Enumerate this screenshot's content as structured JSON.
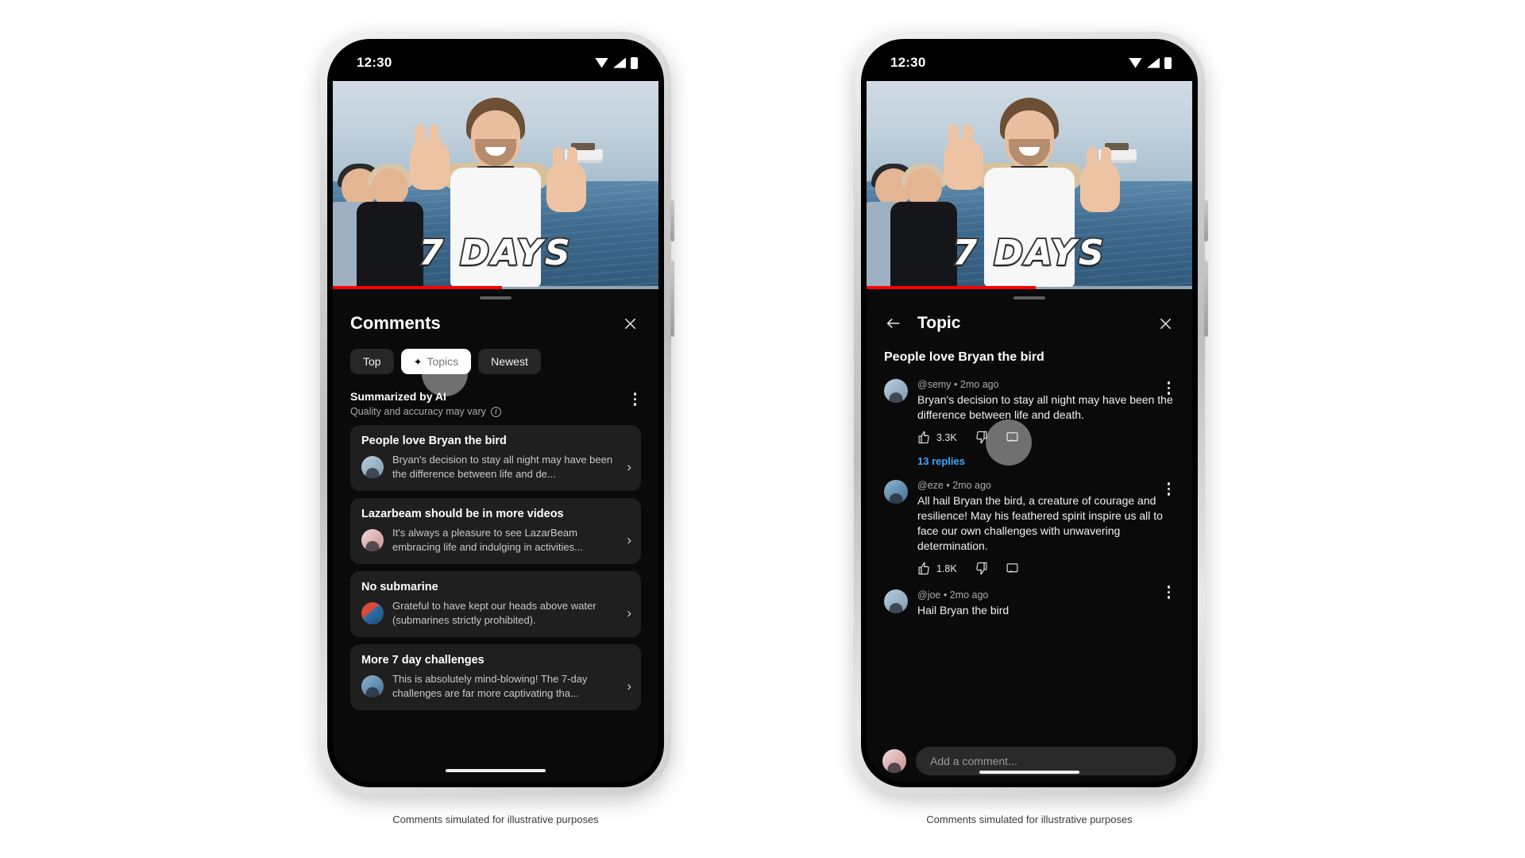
{
  "caption": "Comments simulated for illustrative purposes",
  "status_bar": {
    "time": "12:30",
    "icons": [
      "wifi-icon",
      "signal-icon",
      "battery-icon"
    ]
  },
  "video": {
    "overlay_title": "7 DAYS",
    "progress_percent": 52
  },
  "left_phone": {
    "sheet_title": "Comments",
    "close_label": "×",
    "chips": [
      {
        "label": "Top",
        "active": false,
        "icon": null
      },
      {
        "label": "Topics",
        "active": true,
        "icon": "sparkle-icon"
      },
      {
        "label": "Newest",
        "active": false,
        "icon": null
      }
    ],
    "summary": {
      "title": "Summarized by AI",
      "subtitle": "Quality and accuracy may vary",
      "info_icon": "i"
    },
    "topics": [
      {
        "title": "People love Bryan the bird",
        "snippet": "Bryan's decision to stay all night may have been the difference between life and de...",
        "avatar": "av-a"
      },
      {
        "title": "Lazarbeam should be in more videos",
        "snippet": "It's always a pleasure to see LazarBeam embracing life and indulging in activities...",
        "avatar": "av-b"
      },
      {
        "title": "No submarine",
        "snippet": "Grateful to have kept our heads above water (submarines strictly prohibited).",
        "avatar": "av-c"
      },
      {
        "title": "More 7 day challenges",
        "snippet": "This is absolutely mind-blowing! The 7-day challenges are far more captivating tha...",
        "avatar": "av-d"
      }
    ]
  },
  "right_phone": {
    "header_title": "Topic",
    "back_label": "←",
    "close_label": "×",
    "topic_name": "People love Bryan the bird",
    "comments": [
      {
        "author": "@semy",
        "time": "2mo ago",
        "separator": "•",
        "text": "Bryan's decision to stay all night may have been the difference between life and death.",
        "likes": "3.3K",
        "replies_label": "13 replies"
      },
      {
        "author": "@eze",
        "time": "2mo ago",
        "separator": "•",
        "text": "All hail Bryan the bird, a creature of courage and resilience! May his feathered spirit inspire us all to face our own challenges with unwavering determination.",
        "likes": "1.8K",
        "replies_label": ""
      },
      {
        "author": "@joe",
        "time": "2mo ago",
        "separator": "•",
        "text": "Hail Bryan the bird",
        "likes": "",
        "replies_label": ""
      }
    ],
    "composer_placeholder": "Add a comment..."
  },
  "colors": {
    "accent_red": "#ff0000",
    "link_blue": "#3ea6ff",
    "sheet_bg": "#0a0a0a",
    "card_bg": "#1f1f1f",
    "chip_bg": "#272727"
  }
}
